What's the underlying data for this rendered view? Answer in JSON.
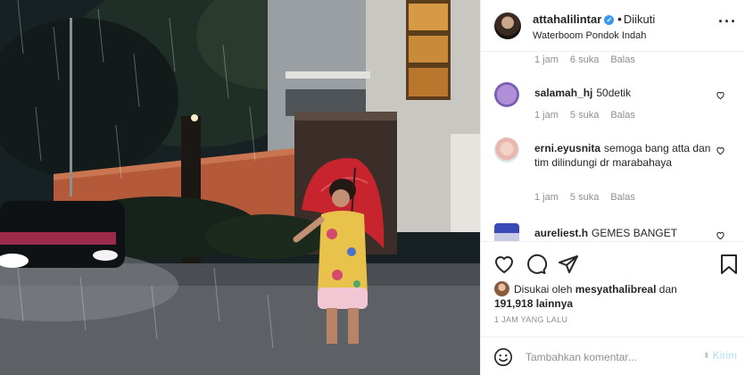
{
  "post": {
    "image_alt": "man standing in flooded street in rain at night holding red umbrella",
    "header": {
      "username": "attahalilintar",
      "verified": true,
      "separator": "•",
      "follow_status": "Diikuti",
      "location": "Waterboom Pondok Indah",
      "more_icon": "more-horizontal-icon"
    },
    "comments": [
      {
        "username": "",
        "text": "",
        "time": "1 jam",
        "likes": "6 suka",
        "reply": "Balas"
      },
      {
        "username": "salamah_hj",
        "text": "50detik",
        "time": "1 jam",
        "likes": "5 suka",
        "reply": "Balas"
      },
      {
        "username": "erni.eyusnita",
        "text": "semoga bang atta dan tim dilindungi dr marabahaya",
        "time": "1 jam",
        "likes": "5 suka",
        "reply": "Balas"
      },
      {
        "username": "aureliest.h",
        "text": "GEMES BANGET",
        "time": "",
        "likes": "",
        "reply": ""
      }
    ],
    "likes": {
      "prefix": "Disukai oleh",
      "first_user": "mesyathalibreal",
      "joiner": "dan",
      "count": "191,918",
      "suffix": "lainnya"
    },
    "timestamp": "1 JAM YANG LALU",
    "add_comment": {
      "placeholder": "Tambahkan komentar...",
      "post_label": "Kirim"
    },
    "colors": {
      "verified": "#3897f0",
      "post_disabled": "#b2dffc",
      "umbrella": "#c8242e"
    }
  }
}
